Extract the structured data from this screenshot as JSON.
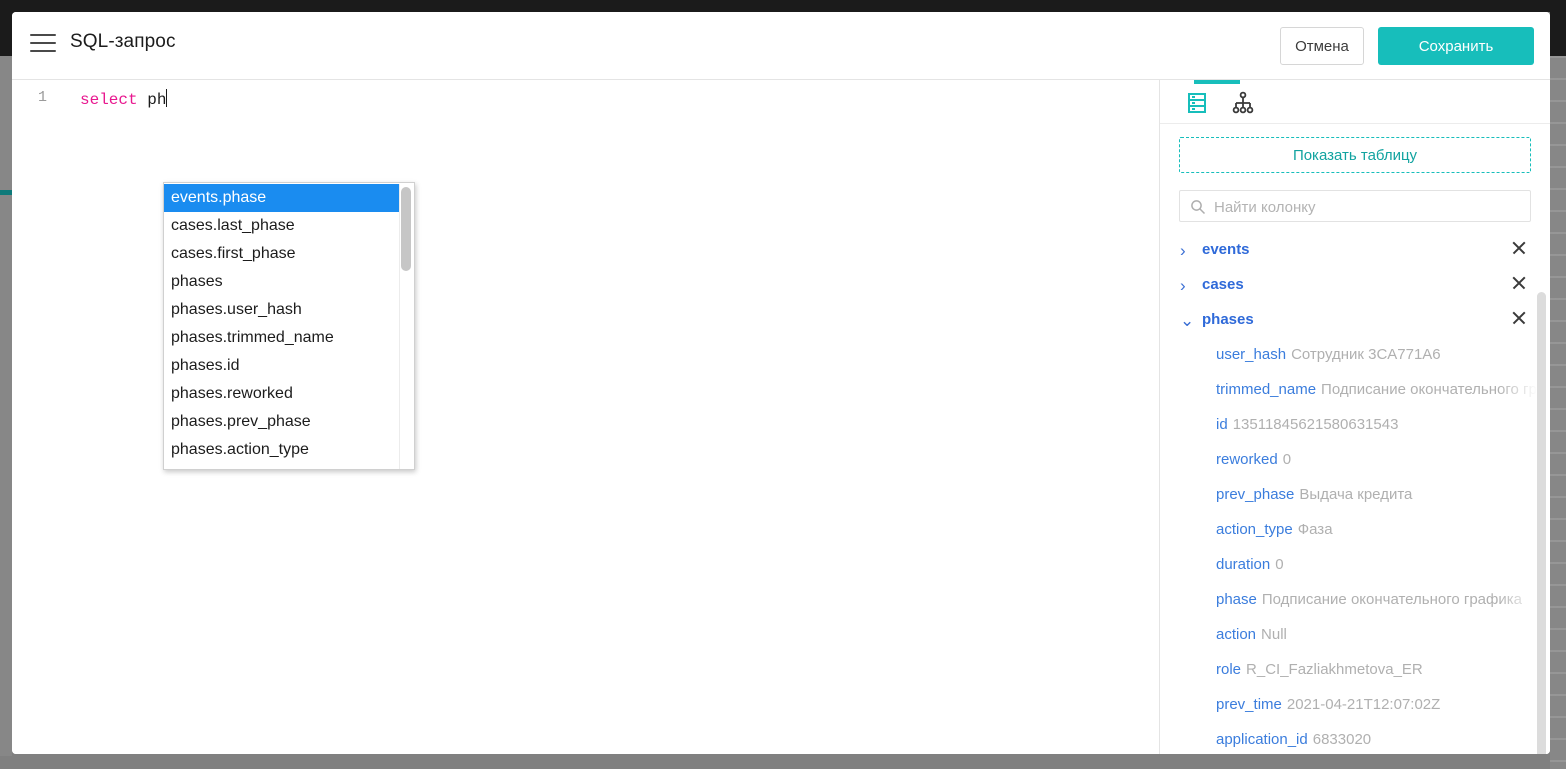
{
  "header": {
    "menu_icon": "hamburger-icon",
    "title": "SQL-запрос",
    "cancel_label": "Отмена",
    "save_label": "Сохранить"
  },
  "editor": {
    "line_number": "1",
    "keyword": "select",
    "identifier": " ph"
  },
  "autocomplete": {
    "items": [
      {
        "label": "events.phase",
        "selected": true
      },
      {
        "label": "cases.last_phase",
        "selected": false
      },
      {
        "label": "cases.first_phase",
        "selected": false
      },
      {
        "label": "phases",
        "selected": false
      },
      {
        "label": "phases.user_hash",
        "selected": false
      },
      {
        "label": "phases.trimmed_name",
        "selected": false
      },
      {
        "label": "phases.id",
        "selected": false
      },
      {
        "label": "phases.reworked",
        "selected": false
      },
      {
        "label": "phases.prev_phase",
        "selected": false
      },
      {
        "label": "phases.action_type",
        "selected": false
      }
    ]
  },
  "sidebar": {
    "tabs": [
      {
        "icon": "table-storage-icon",
        "active": true
      },
      {
        "icon": "hierarchy-tree-icon",
        "active": false
      }
    ],
    "show_table_label": "Показать таблицу",
    "search": {
      "icon": "search-icon",
      "placeholder": "Найти колонку",
      "value": ""
    },
    "tables": [
      {
        "name": "events",
        "expanded": false,
        "chevron": "›",
        "columns": []
      },
      {
        "name": "cases",
        "expanded": false,
        "chevron": "›",
        "columns": []
      },
      {
        "name": "phases",
        "expanded": true,
        "chevron": "⌄",
        "columns": [
          {
            "name": "user_hash",
            "value": "Сотрудник 3CA771A6"
          },
          {
            "name": "trimmed_name",
            "value": "Подписание окончательного графика"
          },
          {
            "name": "id",
            "value": "13511845621580631543"
          },
          {
            "name": "reworked",
            "value": "0"
          },
          {
            "name": "prev_phase",
            "value": "Выдача кредита"
          },
          {
            "name": "action_type",
            "value": "Фаза"
          },
          {
            "name": "duration",
            "value": "0"
          },
          {
            "name": "phase",
            "value": "Подписание окончательного графика"
          },
          {
            "name": "action",
            "value": "Null"
          },
          {
            "name": "role",
            "value": "R_CI_Fazliakhmetova_ER"
          },
          {
            "name": "prev_time",
            "value": "2021-04-21T12:07:02Z"
          },
          {
            "name": "application_id",
            "value": "6833020"
          }
        ]
      }
    ]
  },
  "colors": {
    "accent_teal": "#17bebb",
    "link_blue": "#3b7ddd",
    "table_blue": "#2f6ad9",
    "keyword_pink": "#e8188f",
    "select_blue": "#1a8cf0",
    "muted_gray": "#b0b0b0"
  }
}
